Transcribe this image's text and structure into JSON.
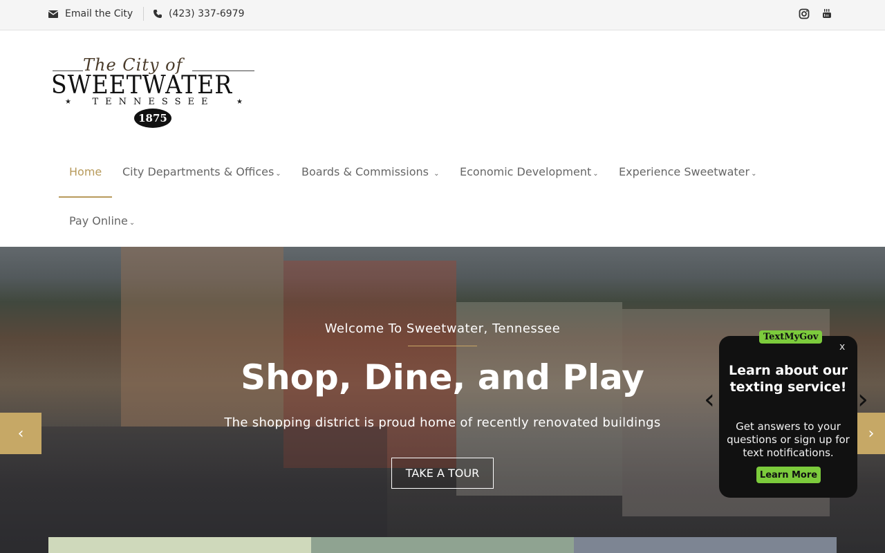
{
  "topbar": {
    "email_label": "Email the City",
    "phone_label": "(423) 337-6979",
    "icons": [
      "envelope-icon",
      "phone-icon",
      "instagram-icon",
      "youtube-icon"
    ]
  },
  "logo": {
    "script": "The City of",
    "main": "SWEETWATER",
    "sub": "TENNESSEE",
    "year": "1875"
  },
  "nav": {
    "items": [
      {
        "label": "Home",
        "active": true
      },
      {
        "label": "City Departments & Offices",
        "caret": true
      },
      {
        "label": "Boards & Commissions",
        "caret": true
      },
      {
        "label": "Economic Development",
        "caret": true
      },
      {
        "label": "Experience Sweetwater",
        "caret": true
      },
      {
        "label": "Pay Online",
        "caret": true
      }
    ],
    "caret_glyph": "⌄"
  },
  "hero": {
    "welcome": "Welcome To Sweetwater, Tennessee",
    "headline": "Shop, Dine, and Play",
    "tagline": "The shopping district is proud home of recently renovated buildings",
    "cta_label": "TAKE A TOUR",
    "prev_glyph": "‹",
    "next_glyph": "›"
  },
  "popup": {
    "brand": "TextMyGov",
    "close": "x",
    "title": "Learn about our texting service!",
    "body": "Get answers to your questions or sign up for text notifications.",
    "button": "Learn More"
  },
  "colors": {
    "accent": "#b79a5b",
    "arrow_bg": "#c6a866",
    "popup_green": "#7ccb3c",
    "popup_bg": "#111111"
  }
}
